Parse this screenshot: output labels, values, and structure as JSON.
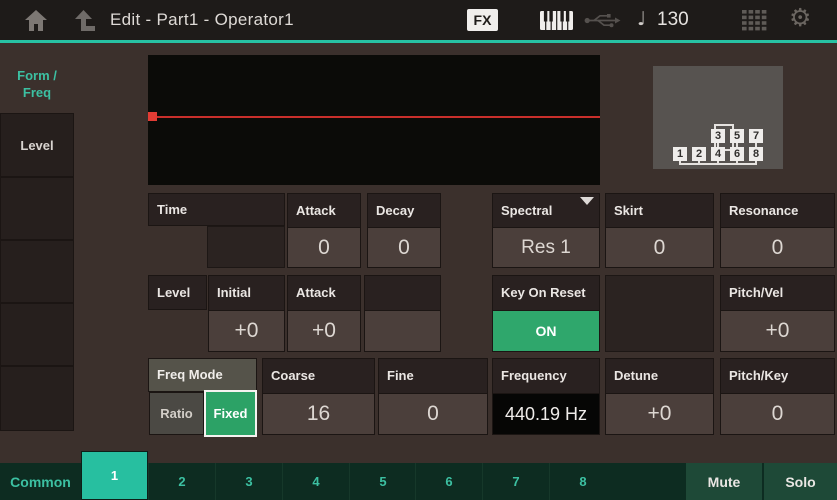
{
  "top_bar": {
    "title": "Edit - Part1 - Operator1",
    "fx_badge": "FX",
    "tempo": "130"
  },
  "colors": {
    "accent_teal": "#27c2a4",
    "button_green": "#2fa76c",
    "envelope_red": "#c92f2b"
  },
  "sidebar": {
    "form_freq_line1": "Form /",
    "form_freq_line2": "Freq",
    "level_label": "Level"
  },
  "algorithm": {
    "top_row": [
      "3",
      "5",
      "7"
    ],
    "bottom_row": [
      "1",
      "2",
      "4",
      "6",
      "8"
    ]
  },
  "params": {
    "time": {
      "label": "Time"
    },
    "attack_time": {
      "label": "Attack",
      "value": "0"
    },
    "decay_time": {
      "label": "Decay",
      "value": "0"
    },
    "spectral": {
      "label": "Spectral",
      "value": "Res 1"
    },
    "skirt": {
      "label": "Skirt",
      "value": "0"
    },
    "resonance": {
      "label": "Resonance",
      "value": "0"
    },
    "level": {
      "label": "Level"
    },
    "initial_level": {
      "label": "Initial",
      "value": "+0"
    },
    "attack_level": {
      "label": "Attack",
      "value": "+0"
    },
    "key_on_reset": {
      "label": "Key On Reset",
      "value": "ON"
    },
    "pitch_vel": {
      "label": "Pitch/Vel",
      "value": "+0"
    },
    "freq_mode": {
      "label": "Freq Mode",
      "options": [
        "Ratio",
        "Fixed"
      ],
      "selected": "Fixed"
    },
    "coarse": {
      "label": "Coarse",
      "value": "16"
    },
    "fine": {
      "label": "Fine",
      "value": "0"
    },
    "frequency": {
      "label": "Frequency",
      "value": "440.19 Hz"
    },
    "detune": {
      "label": "Detune",
      "value": "+0"
    },
    "pitch_key": {
      "label": "Pitch/Key",
      "value": "0"
    }
  },
  "bottom_bar": {
    "common_label": "Common",
    "tabs": [
      "1",
      "2",
      "3",
      "4",
      "5",
      "6",
      "7",
      "8"
    ],
    "selected_tab": "1",
    "mute_label": "Mute",
    "solo_label": "Solo"
  }
}
